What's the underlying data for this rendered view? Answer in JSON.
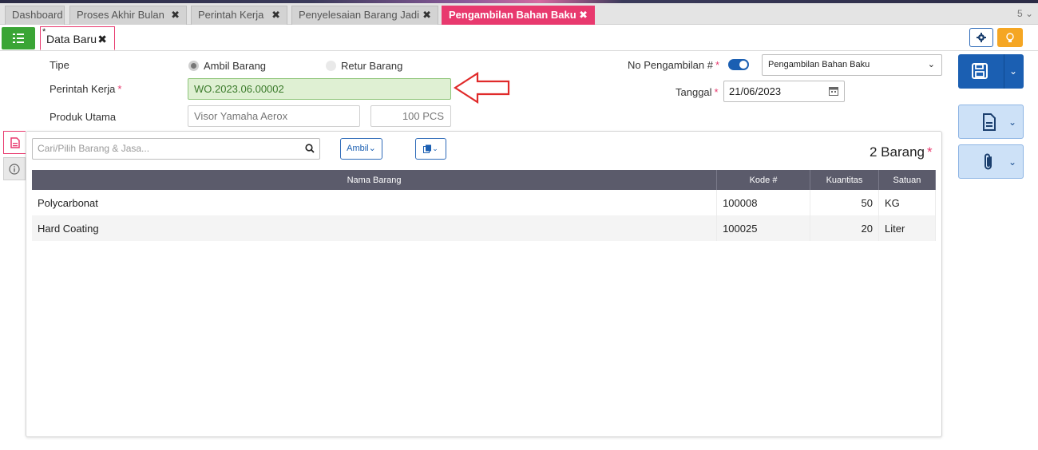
{
  "tabs": [
    {
      "label": "Dashboard",
      "closable": false
    },
    {
      "label": "Proses Akhir Bulan",
      "closable": true
    },
    {
      "label": "Perintah Kerja",
      "closable": true
    },
    {
      "label": "Penyelesaian Barang Jadi",
      "closable": true
    },
    {
      "label": "Pengambilan Bahan Baku",
      "closable": true,
      "active": true
    }
  ],
  "tab_count": "5 ⌄",
  "doc_tab": {
    "modified_mark": "*",
    "label": "Data Baru"
  },
  "form": {
    "tipe_label": "Tipe",
    "tipe_options": [
      "Ambil Barang",
      "Retur Barang"
    ],
    "tipe_selected": "Ambil Barang",
    "perintah_kerja_label": "Perintah Kerja",
    "perintah_kerja_value": "WO.2023.06.00002",
    "produk_utama_label": "Produk Utama",
    "produk_utama_value": "Visor Yamaha Aerox",
    "produk_qty": "100 PCS",
    "no_pengambilan_label": "No Pengambilan #",
    "no_pengambilan_select": "Pengambilan Bahan Baku",
    "tanggal_label": "Tanggal",
    "tanggal_value": "21/06/2023",
    "required_mark": "*"
  },
  "items_panel": {
    "search_placeholder": "Cari/Pilih Barang & Jasa...",
    "ambil_label": "Ambil",
    "count_label": "2 Barang",
    "columns": [
      "Nama Barang",
      "Kode #",
      "Kuantitas",
      "Satuan"
    ],
    "rows": [
      {
        "nama": "Polycarbonat",
        "kode": "100008",
        "qty": "50",
        "satuan": "KG"
      },
      {
        "nama": "Hard Coating",
        "kode": "100025",
        "qty": "20",
        "satuan": "Liter"
      }
    ]
  },
  "colors": {
    "accent": "#e8396e",
    "primary": "#1b5fb2",
    "success": "#3aa535",
    "warning": "#f5a623"
  }
}
